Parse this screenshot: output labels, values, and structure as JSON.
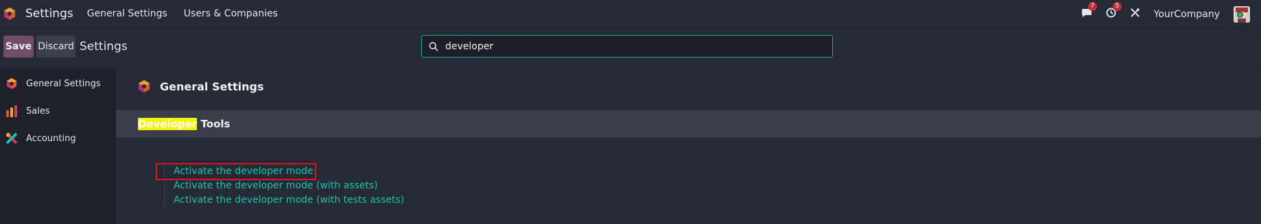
{
  "navbar": {
    "app_title": "Settings",
    "menus": [
      "General Settings",
      "Users & Companies"
    ],
    "messages_count": "7",
    "activities_count": "5",
    "company": "YourCompany"
  },
  "control_panel": {
    "save_label": "Save",
    "discard_label": "Discard",
    "title": "Settings",
    "search_value": "developer"
  },
  "sidebar": {
    "items": [
      {
        "label": "General Settings",
        "icon": "odoo-logo-icon"
      },
      {
        "label": "Sales",
        "icon": "sales-chart-icon"
      },
      {
        "label": "Accounting",
        "icon": "accounting-icon"
      }
    ]
  },
  "main": {
    "section_title": "General Settings",
    "group_title_highlight": "Developer",
    "group_title_rest": " Tools",
    "links": [
      "Activate the developer mode",
      "Activate the developer mode (with assets)",
      "Activate the developer mode (with tests assets)"
    ]
  },
  "colors": {
    "accent": "#1bc3ad",
    "primary_button": "#714b67",
    "highlight": "#f4f40a",
    "focus_box": "#e0121b"
  }
}
